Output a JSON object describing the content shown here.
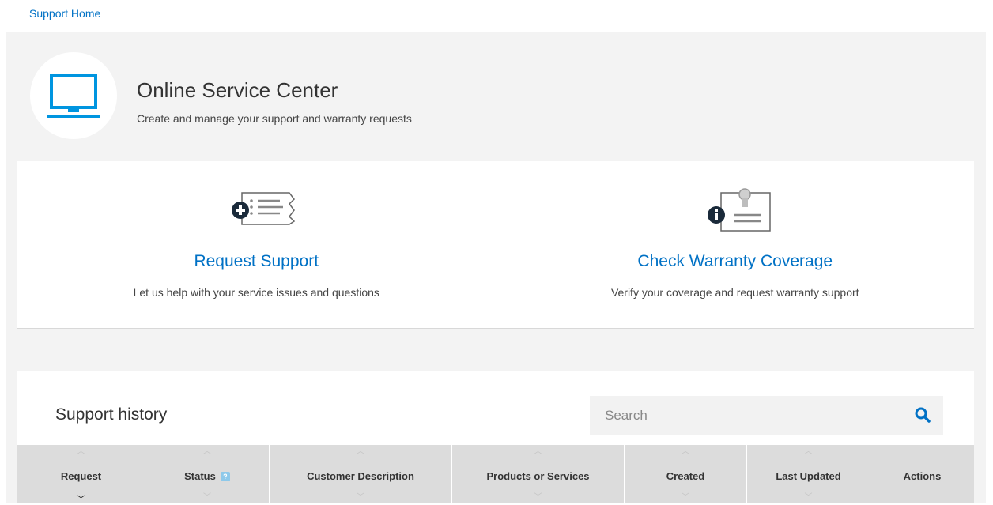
{
  "breadcrumb": {
    "label": "Support Home"
  },
  "hero": {
    "icon": "monitor-icon",
    "title": "Online Service Center",
    "subtitle": "Create and manage your support and warranty requests"
  },
  "cards": [
    {
      "icon": "add-request-icon",
      "title": "Request Support",
      "description": "Let us help with your service issues and questions"
    },
    {
      "icon": "warranty-certificate-icon",
      "title": "Check Warranty Coverage",
      "description": "Verify your coverage and request warranty support"
    }
  ],
  "history": {
    "title": "Support history",
    "search": {
      "placeholder": "Search",
      "value": "",
      "icon": "search-icon"
    },
    "columns": [
      {
        "label": "Request",
        "sorted": "desc"
      },
      {
        "label": "Status",
        "help_icon": "?"
      },
      {
        "label": "Customer Description"
      },
      {
        "label": "Products or Services"
      },
      {
        "label": "Created"
      },
      {
        "label": "Last Updated"
      },
      {
        "label": "Actions"
      }
    ]
  },
  "colors": {
    "accent": "#0071c5",
    "panel_bg": "#f3f3f3",
    "table_header_bg": "#dcdcdc",
    "icon_dark": "#1a2a3a"
  }
}
